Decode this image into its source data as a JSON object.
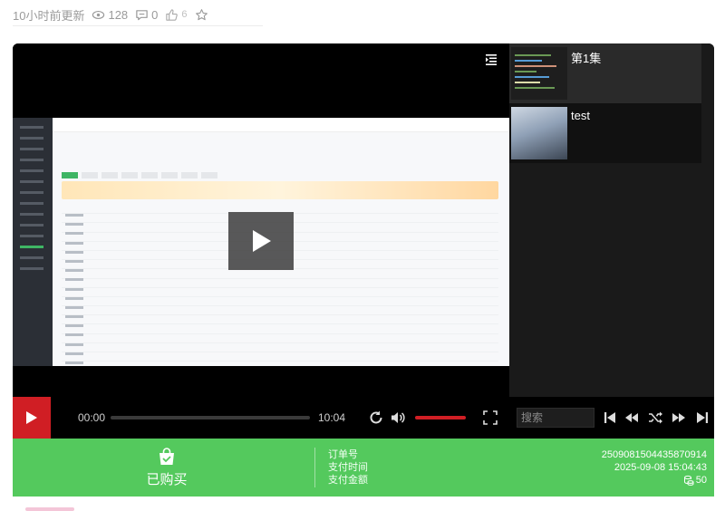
{
  "meta": {
    "updated": "10小时前更新",
    "views": "128",
    "comments": "0",
    "likes": "6"
  },
  "player": {
    "current_time": "00:00",
    "duration": "10:04",
    "progress": 0,
    "volume": 1.0,
    "search_placeholder": "搜索"
  },
  "playlist": {
    "items": [
      {
        "title": "第1集",
        "thumb": "code-editor"
      },
      {
        "title": "test",
        "thumb": "cloudy-sky"
      }
    ]
  },
  "purchase": {
    "status": "已购买",
    "labels": [
      "订单号",
      "支付时间",
      "支付金额"
    ],
    "order_no": "2509081504435870914",
    "paid_at": "2025-09-08 15:04:43",
    "amount": "50"
  },
  "colors": {
    "accent_red": "#d01e24",
    "buy_green": "#54c95d"
  }
}
